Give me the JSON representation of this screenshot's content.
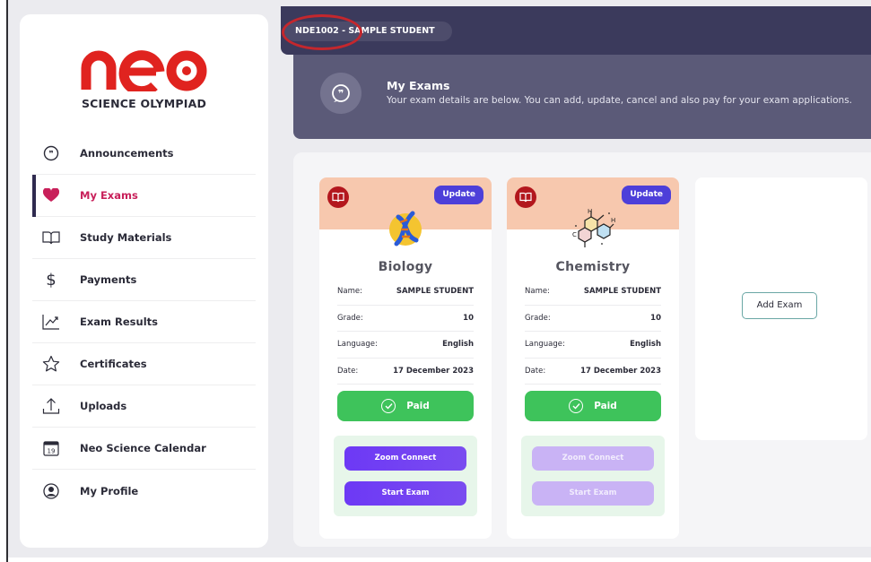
{
  "student": {
    "label": "NDE1002 - SAMPLE STUDENT"
  },
  "brand": {
    "logo_text": "neo",
    "subtitle": "SCIENCE OLYMPIAD",
    "logo_color": "#e0231f"
  },
  "sidebar": {
    "items": [
      {
        "label": "Announcements",
        "icon": "quote-bubble-icon"
      },
      {
        "label": "My Exams",
        "icon": "heart-icon",
        "active": true
      },
      {
        "label": "Study Materials",
        "icon": "open-book-icon"
      },
      {
        "label": "Payments",
        "icon": "dollar-icon"
      },
      {
        "label": "Exam Results",
        "icon": "trend-chart-icon"
      },
      {
        "label": "Certificates",
        "icon": "star-icon"
      },
      {
        "label": "Uploads",
        "icon": "upload-icon"
      },
      {
        "label": "Neo Science Calendar",
        "icon": "calendar-icon",
        "calendar_day": "19"
      },
      {
        "label": "My Profile",
        "icon": "user-icon"
      }
    ]
  },
  "header": {
    "title": "My Exams",
    "subtitle": "Your exam details are below. You can add, update, cancel and also pay for your exam applications."
  },
  "exams": [
    {
      "subject": "Biology",
      "update_label": "Update",
      "fields": [
        {
          "key": "Name:",
          "value": "SAMPLE STUDENT"
        },
        {
          "key": "Grade:",
          "value": "10"
        },
        {
          "key": "Language:",
          "value": "English"
        },
        {
          "key": "Date:",
          "value": "17 December 2023"
        }
      ],
      "status": "Paid",
      "zoom_label": "Zoom Connect",
      "start_label": "Start Exam",
      "actions_enabled": true
    },
    {
      "subject": "Chemistry",
      "update_label": "Update",
      "fields": [
        {
          "key": "Name:",
          "value": "SAMPLE STUDENT"
        },
        {
          "key": "Grade:",
          "value": "10"
        },
        {
          "key": "Language:",
          "value": "English"
        },
        {
          "key": "Date:",
          "value": "17 December 2023"
        }
      ],
      "status": "Paid",
      "zoom_label": "Zoom Connect",
      "start_label": "Start Exam",
      "actions_enabled": false,
      "molecule_labels": [
        "H",
        "H",
        "C"
      ]
    }
  ],
  "add_exam": {
    "label": "Add Exam"
  },
  "colors": {
    "header_dark": "#3b3a5c",
    "banner": "#5b5a78",
    "accent_active": "#c8205a",
    "paid_green": "#3ec35b",
    "update_blue": "#4d3fd9",
    "action_purple": "#6d39f5",
    "card_head_peach": "#f7c8ae",
    "annotation_red": "#c4272d"
  }
}
